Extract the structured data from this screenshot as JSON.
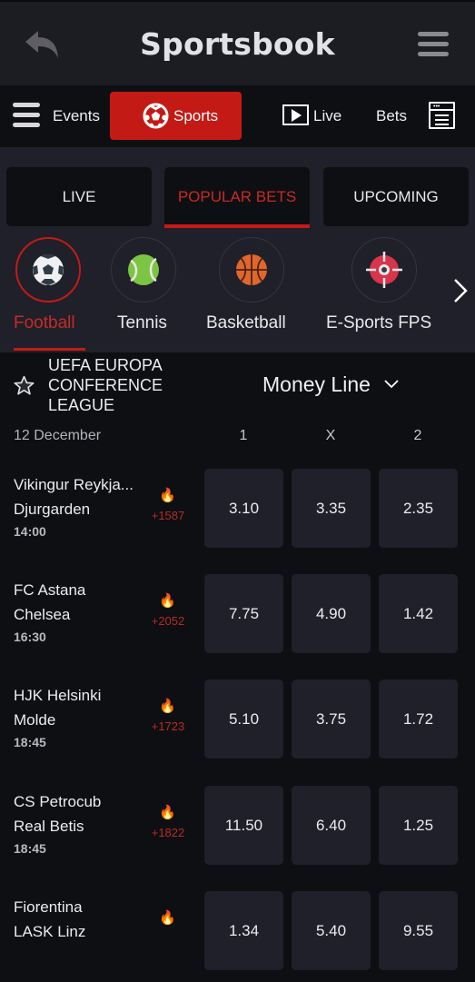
{
  "header": {
    "title": "Sportsbook",
    "back_icon": "back-arrow-icon",
    "menu_icon": "hamburger-icon"
  },
  "nav": {
    "events_label": "Events",
    "sports_label": "Sports",
    "live_label": "Live",
    "bets_label": "Bets",
    "accent": "#c41a15"
  },
  "tabs": [
    {
      "label": "LIVE",
      "active": false
    },
    {
      "label": "POPULAR BETS",
      "active": true
    },
    {
      "label": "UPCOMING",
      "active": false
    }
  ],
  "sports": [
    {
      "label": "Football",
      "icon": "soccer-ball-icon",
      "active": true
    },
    {
      "label": "Tennis",
      "icon": "tennis-ball-icon",
      "active": false
    },
    {
      "label": "Basketball",
      "icon": "basketball-icon",
      "active": false
    },
    {
      "label": "E-Sports FPS",
      "icon": "crosshair-icon",
      "active": false
    }
  ],
  "league": {
    "name_lines": [
      "UEFA EUROPA",
      "CONFERENCE",
      "LEAGUE"
    ],
    "market": "Money Line",
    "date": "12 December",
    "columns": [
      "1",
      "X",
      "2"
    ]
  },
  "matches": [
    {
      "home": "Vikingur Reykja...",
      "away": "Djurgarden",
      "time": "14:00",
      "hot": "+1587",
      "odds": [
        "3.10",
        "3.35",
        "2.35"
      ]
    },
    {
      "home": "FC Astana",
      "away": "Chelsea",
      "time": "16:30",
      "hot": "+2052",
      "odds": [
        "7.75",
        "4.90",
        "1.42"
      ]
    },
    {
      "home": "HJK Helsinki",
      "away": "Molde",
      "time": "18:45",
      "hot": "+1723",
      "odds": [
        "5.10",
        "3.75",
        "1.72"
      ]
    },
    {
      "home": "CS Petrocub",
      "away": "Real Betis",
      "time": "18:45",
      "hot": "+1822",
      "odds": [
        "11.50",
        "6.40",
        "1.25"
      ]
    },
    {
      "home": "Fiorentina",
      "away": "LASK Linz",
      "time": "",
      "hot": "",
      "odds": [
        "1.34",
        "5.40",
        "9.55"
      ]
    }
  ]
}
